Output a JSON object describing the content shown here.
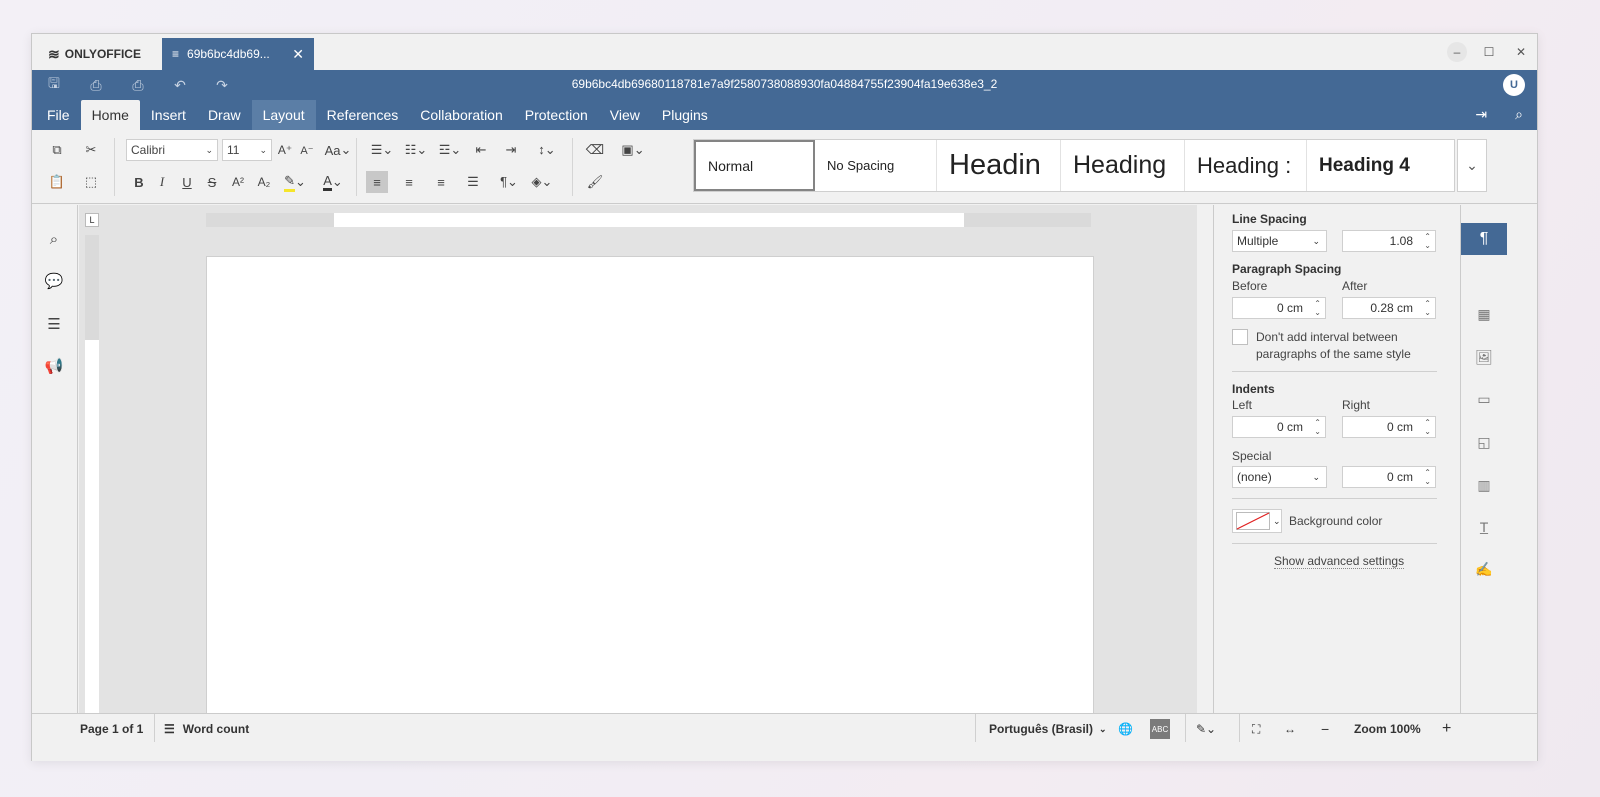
{
  "app": {
    "brand": "ONLYOFFICE",
    "doc_tab_label": "69b6bc4db69...",
    "doc_title": "69b6bc4db69680118781e7a9f2580738088930fa04884755f23904fa19e638e3_2",
    "avatar_initial": "U",
    "accent": "#446995"
  },
  "menu": {
    "tabs": [
      "File",
      "Home",
      "Insert",
      "Draw",
      "Layout",
      "References",
      "Collaboration",
      "Protection",
      "View",
      "Plugins"
    ],
    "active": "Home"
  },
  "toolbar": {
    "font_name": "Calibri",
    "font_size": "11",
    "bold": "B",
    "italic": "I",
    "underline": "U",
    "strike": "S",
    "superscript": "A²",
    "subscript": "A₂",
    "grow": "A⁺",
    "shrink": "A⁻",
    "change_case": "Aa",
    "styles": [
      "Normal",
      "No Spacing",
      "Headin",
      "Heading",
      "Heading :",
      "Heading 4"
    ]
  },
  "ruler": {
    "corner": "L"
  },
  "paragraph_panel": {
    "line_spacing_title": "Line Spacing",
    "line_spacing_mode": "Multiple",
    "line_spacing_value": "1.08",
    "paragraph_spacing_title": "Paragraph Spacing",
    "before_label": "Before",
    "after_label": "After",
    "before_value": "0 cm",
    "after_value": "0.28 cm",
    "dont_add_interval": "Don't add interval between paragraphs of the same style",
    "indents_title": "Indents",
    "left_label": "Left",
    "right_label": "Right",
    "left_value": "0 cm",
    "right_value": "0 cm",
    "special_label": "Special",
    "special_value": "(none)",
    "special_amount": "0 cm",
    "background_color_label": "Background color",
    "advanced_link": "Show advanced settings"
  },
  "statusbar": {
    "page_info": "Page 1 of 1",
    "word_count": "Word count",
    "language": "Português (Brasil)",
    "zoom": "Zoom 100%"
  }
}
